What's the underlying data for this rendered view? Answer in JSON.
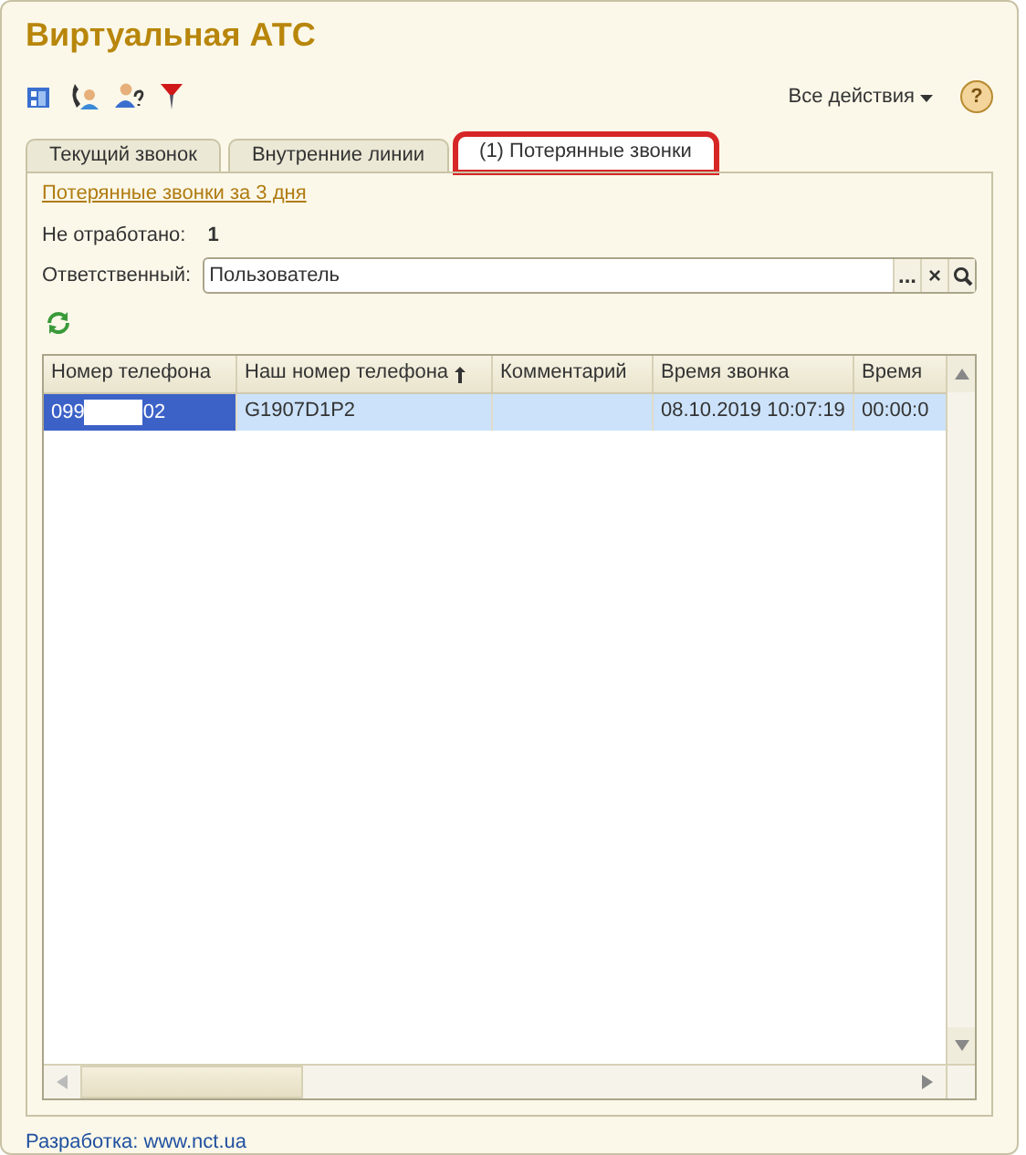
{
  "window": {
    "title": "Виртуальная АТС"
  },
  "toolbar": {
    "all_actions": "Все действия",
    "help": "?"
  },
  "tabs": [
    {
      "label": "Текущий звонок",
      "selected": false,
      "highlighted": false
    },
    {
      "label": "Внутренние линии",
      "selected": false,
      "highlighted": false
    },
    {
      "label": "(1) Потерянные звонки",
      "selected": true,
      "highlighted": true
    }
  ],
  "period_link": "Потерянные звонки за 3 дня",
  "unprocessed": {
    "label": "Не отработано:",
    "value": "1"
  },
  "responsible": {
    "label": "Ответственный:",
    "value": "Пользователь",
    "choose": "...",
    "clear": "×"
  },
  "table": {
    "columns": [
      {
        "label": "Номер телефона",
        "sorted": false
      },
      {
        "label": "Наш номер телефона",
        "sorted": true
      },
      {
        "label": "Комментарий",
        "sorted": false
      },
      {
        "label": "Время звонка",
        "sorted": false
      },
      {
        "label": "Время",
        "sorted": false
      }
    ],
    "rows": [
      {
        "selected": true,
        "cells": [
          {
            "kind": "redacted",
            "start": "099",
            "end": "02"
          },
          {
            "kind": "text",
            "text": "G1907D1P2"
          },
          {
            "kind": "text",
            "text": ""
          },
          {
            "kind": "text",
            "text": "08.10.2019 10:07:19"
          },
          {
            "kind": "text",
            "text": "00:00:0"
          }
        ]
      }
    ]
  },
  "footer": {
    "label": "Разработка:",
    "link": "www.nct.ua"
  }
}
